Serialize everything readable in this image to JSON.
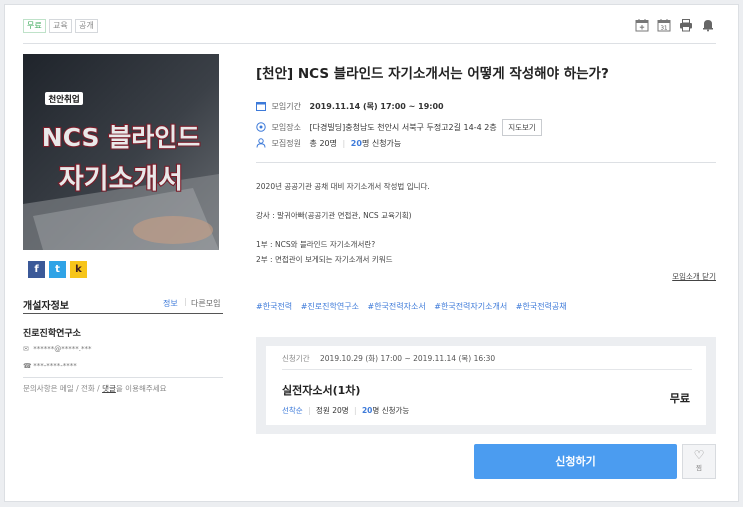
{
  "tags": [
    "무료",
    "교육",
    "공개"
  ],
  "toolbar_icons": [
    "calendar-add-icon",
    "calendar-31-icon",
    "print-icon",
    "bell-icon"
  ],
  "calendar_day": "31",
  "thumbnail": {
    "line1": "NCS 블라인드",
    "line2": "자기소개서",
    "badge": "천안취업"
  },
  "share": {
    "facebook": "f",
    "twitter": "t",
    "kakao": "k"
  },
  "organizer": {
    "section_title": "개설자정보",
    "info_link": "정보",
    "other_link": "다른모임",
    "name": "진로진학연구소",
    "email": "******@*****.***",
    "phone": "***-****-****",
    "note_prefix": "문의사항은 메일 / 전화 / ",
    "note_link": "댓글",
    "note_suffix": "을 이용해주세요"
  },
  "event": {
    "title": "[천안] NCS 블라인드 자기소개서는 어떻게 작성해야 하는가?",
    "period_label": "모임기간",
    "period_value": "2019.11.14 (목) 17:00 ~ 19:00",
    "place_label": "모임장소",
    "place_value": "[다경빌딩]충청남도 천안시 서북구 두정고2길 14-4 2층",
    "map_button": "지도보기",
    "capacity_label": "모집정원",
    "capacity_total": "총 20명",
    "capacity_sep": "|",
    "capacity_available": "20",
    "capacity_suffix": "명 신청가능"
  },
  "description": {
    "line1": "2020년 공공기관 공채 대비 자기소개서 작성법 입니다.",
    "line2": "강사 : 말귀아빠(공공기관 면접관, NCS 교육기획)",
    "line3": "1부 : NCS와 블라인드 자기소개서란?",
    "line4": "2부 : 면접관이 보게되는 자기소개서 키워드",
    "fold_link": "모임소개 닫기"
  },
  "hashtags": [
    "#한국전력",
    "#진로진학연구소",
    "#한국전력자소서",
    "#한국전력자기소개서",
    "#한국전력공채"
  ],
  "ticket": {
    "period_label": "신청기간",
    "period_value": "2019.10.29 (화) 17:00 ~ 2019.11.14 (목) 16:30",
    "name": "실전자소서(1차)",
    "order": "선착순",
    "sep": "|",
    "capacity": "정원 20명",
    "available": "20",
    "available_suffix": "명 신청가능",
    "price": "무료"
  },
  "apply_button": "신청하기",
  "like": {
    "icon": "heart-icon",
    "label": "찜"
  },
  "colors": {
    "accent": "#4b9cf0",
    "link": "#3d7ad9",
    "free_tag": "#3aa757"
  }
}
